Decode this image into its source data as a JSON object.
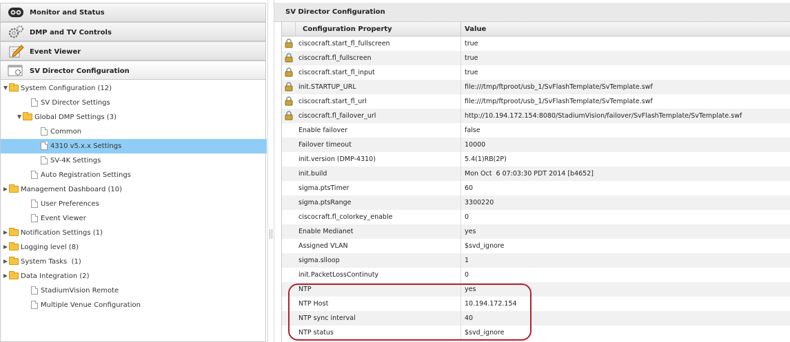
{
  "sidebar": {
    "panels": [
      {
        "label": "Monitor and Status",
        "icon": "monitor-icon"
      },
      {
        "label": "DMP and TV Controls",
        "icon": "gears-icon"
      },
      {
        "label": "Event Viewer",
        "icon": "pencil-icon"
      },
      {
        "label": "SV Director Configuration",
        "icon": "config-icon"
      }
    ],
    "tree": [
      {
        "label": "System Configuration (12)",
        "type": "folder",
        "state": "expanded"
      },
      {
        "label": "SV Director Settings",
        "type": "file"
      },
      {
        "label": "Global DMP Settings (3)",
        "type": "folder",
        "state": "expanded"
      },
      {
        "label": "Common",
        "type": "file"
      },
      {
        "label": "4310 v5.x.x Settings",
        "type": "file",
        "selected": true
      },
      {
        "label": "SV-4K Settings",
        "type": "file"
      },
      {
        "label": "Auto Registration Settings",
        "type": "file"
      },
      {
        "label": "Management Dashboard (10)",
        "type": "folder",
        "state": "collapsed"
      },
      {
        "label": "User Preferences",
        "type": "file"
      },
      {
        "label": "Event Viewer",
        "type": "file"
      },
      {
        "label": "Notification Settings (1)",
        "type": "folder",
        "state": "collapsed"
      },
      {
        "label": "Logging level (8)",
        "type": "folder",
        "state": "collapsed"
      },
      {
        "label": "System Tasks  (1)",
        "type": "folder",
        "state": "collapsed"
      },
      {
        "label": "Data Integration (2)",
        "type": "folder",
        "state": "collapsed"
      },
      {
        "label": "StadiumVision Remote",
        "type": "file"
      },
      {
        "label": "Multiple Venue Configuration",
        "type": "file"
      }
    ]
  },
  "main": {
    "title": "SV Director Configuration",
    "columns": {
      "property": "Configuration Property",
      "value": "Value"
    },
    "rows": [
      {
        "property": "ciscocraft.start_fl_fullscreen",
        "value": "true",
        "locked": true
      },
      {
        "property": "ciscocraft.fl_fullscreen",
        "value": "true",
        "locked": true
      },
      {
        "property": "ciscocraft.start_fl_input",
        "value": "true",
        "locked": true
      },
      {
        "property": "init.STARTUP_URL",
        "value": "file:///tmp/ftproot/usb_1/SvFlashTemplate/SvTemplate.swf",
        "locked": true
      },
      {
        "property": "ciscocraft.start_fl_url",
        "value": "file:///tmp/ftproot/usb_1/SvFlashTemplate/SvTemplate.swf",
        "locked": true
      },
      {
        "property": "ciscocraft.fl_failover_url",
        "value": "http://10.194.172.154:8080/StadiumVision/failover/SvFlashTemplate/SvTemplate.swf",
        "locked": true
      },
      {
        "property": "Enable failover",
        "value": "false",
        "locked": false
      },
      {
        "property": "Failover timeout",
        "value": "10000",
        "locked": false
      },
      {
        "property": "init.version (DMP-4310)",
        "value": "5.4(1)RB(2P)",
        "locked": false
      },
      {
        "property": "init.build",
        "value": "Mon Oct  6 07:03:30 PDT 2014 [b4652]",
        "locked": false
      },
      {
        "property": "sigma.ptsTimer",
        "value": "60",
        "locked": false
      },
      {
        "property": "sigma.ptsRange",
        "value": "3300220",
        "locked": false
      },
      {
        "property": "ciscocraft.fl_colorkey_enable",
        "value": "0",
        "locked": false
      },
      {
        "property": "Enable Medianet",
        "value": "yes",
        "locked": false
      },
      {
        "property": "Assigned VLAN",
        "value": "$svd_ignore",
        "locked": false
      },
      {
        "property": "sigma.slloop",
        "value": "1",
        "locked": false
      },
      {
        "property": "init.PacketLossContinuty",
        "value": "0",
        "locked": false
      },
      {
        "property": "NTP",
        "value": "yes",
        "locked": false
      },
      {
        "property": "NTP Host",
        "value": "10.194.172.154",
        "locked": false
      },
      {
        "property": "NTP sync interval",
        "value": "40",
        "locked": false
      },
      {
        "property": "NTP status",
        "value": "$svd_ignore",
        "locked": false
      }
    ],
    "highlight_color": "#b1222a"
  },
  "colors": {
    "selected": "#8fcdf6",
    "folder": "#f6c440",
    "lock": "#c9a53a"
  }
}
